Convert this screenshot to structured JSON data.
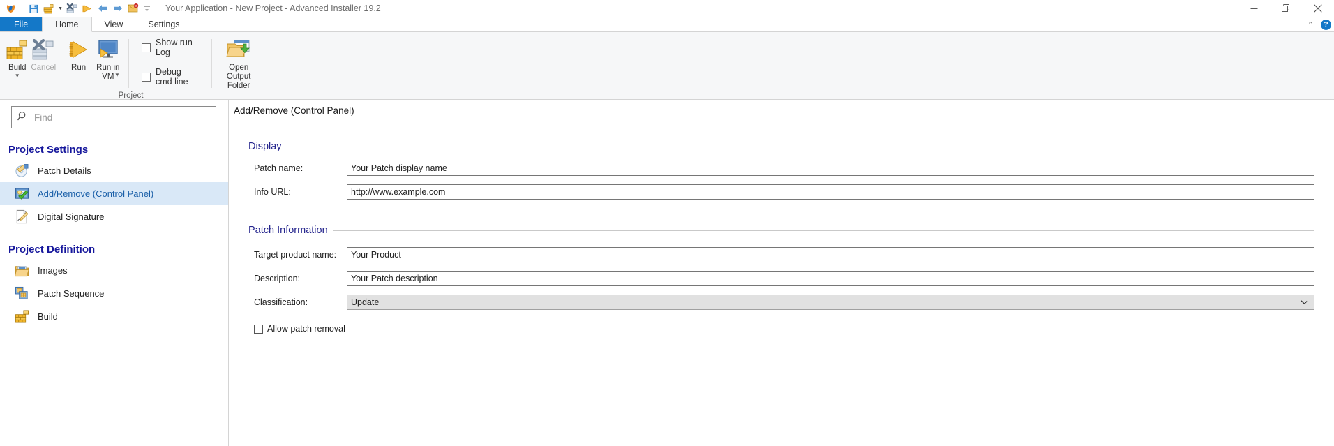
{
  "window": {
    "title": "Your Application - New Project - Advanced Installer 19.2",
    "minimize_label": "—",
    "restore_label": "❐",
    "close_label": "✕"
  },
  "quick_access": {
    "items": [
      {
        "name": "app-logo-icon",
        "label": ""
      },
      {
        "name": "save-icon",
        "label": ""
      },
      {
        "name": "new-project-icon",
        "label": ""
      },
      {
        "name": "qat-dropdown-caret",
        "label": "▾"
      },
      {
        "name": "build-icon",
        "label": ""
      },
      {
        "name": "run-icon",
        "label": ""
      },
      {
        "name": "back-arrow-icon",
        "label": "←"
      },
      {
        "name": "forward-arrow-icon",
        "label": "→"
      },
      {
        "name": "notifications-icon",
        "label": "99"
      },
      {
        "name": "qat-customize-icon",
        "label": "☰"
      }
    ]
  },
  "tabs": [
    {
      "id": "file",
      "label": "File"
    },
    {
      "id": "home",
      "label": "Home"
    },
    {
      "id": "view",
      "label": "View"
    },
    {
      "id": "settings",
      "label": "Settings"
    }
  ],
  "tabstrip_right": {
    "collapse_label": "⌃",
    "help_label": "?"
  },
  "ribbon": {
    "group_title": "Project",
    "buttons": [
      {
        "name": "build-button",
        "label": "Build",
        "has_caret": true,
        "disabled": false
      },
      {
        "name": "cancel-button",
        "label": "Cancel",
        "has_caret": false,
        "disabled": true
      },
      {
        "name": "run-button",
        "label": "Run",
        "has_caret": false,
        "disabled": false
      },
      {
        "name": "run-in-vm-button",
        "label": "Run in\nVM",
        "has_caret": true,
        "disabled": false
      }
    ],
    "checkboxes": [
      {
        "name": "show-run-log-checkbox",
        "label": "Show run Log",
        "checked": false
      },
      {
        "name": "debug-cmd-line-checkbox",
        "label": "Debug cmd line",
        "checked": false
      }
    ],
    "open_output_folder": {
      "label": "Open Output\nFolder"
    }
  },
  "sidebar": {
    "search": {
      "placeholder": "Find",
      "value": ""
    },
    "sections": [
      {
        "title": "Project Settings",
        "items": [
          {
            "label": "Patch Details",
            "icon": "patch-details-icon",
            "selected": false
          },
          {
            "label": "Add/Remove (Control Panel)",
            "icon": "add-remove-icon",
            "selected": true
          },
          {
            "label": "Digital Signature",
            "icon": "digital-signature-icon",
            "selected": false
          }
        ]
      },
      {
        "title": "Project Definition",
        "items": [
          {
            "label": "Images",
            "icon": "images-icon",
            "selected": false
          },
          {
            "label": "Patch Sequence",
            "icon": "patch-sequence-icon",
            "selected": false
          },
          {
            "label": "Build",
            "icon": "build-icon",
            "selected": false
          }
        ]
      }
    ]
  },
  "content": {
    "header_title": "Add/Remove (Control Panel)",
    "sections": [
      {
        "title": "Display",
        "fields": [
          {
            "type": "text",
            "label": "Patch name:",
            "value": "Your Patch display name",
            "name": "patch-name-field"
          },
          {
            "type": "text",
            "label": "Info URL:",
            "value": "http://www.example.com",
            "name": "info-url-field"
          }
        ]
      },
      {
        "title": "Patch Information",
        "fields": [
          {
            "type": "text",
            "label": "Target product name:",
            "value": "Your Product",
            "name": "target-product-name-field"
          },
          {
            "type": "text",
            "label": "Description:",
            "value": "Your Patch description",
            "name": "description-field"
          },
          {
            "type": "combo",
            "label": "Classification:",
            "value": "Update",
            "name": "classification-combo",
            "caret": "⌄"
          }
        ],
        "checkbox": {
          "label": "Allow patch removal",
          "checked": false,
          "name": "allow-patch-removal-checkbox"
        }
      }
    ]
  },
  "colors": {
    "accent": "#1478c8",
    "section_heading": "#26268e",
    "sidebar_heading": "#16179c",
    "selection_bg": "#d9e8f7",
    "selection_text": "#1a5fa8"
  }
}
